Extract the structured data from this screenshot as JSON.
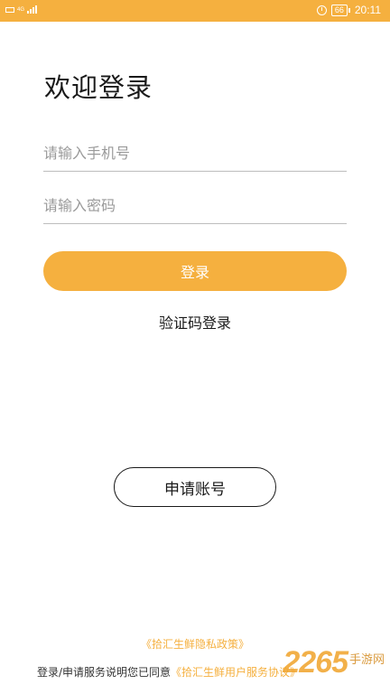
{
  "statusbar": {
    "network": "4G",
    "battery": "66",
    "time": "20:11",
    "icons": [
      "sim-icon",
      "signal-icon",
      "alarm-icon",
      "battery-icon"
    ]
  },
  "title": "欢迎登录",
  "form": {
    "phone_placeholder": "请输入手机号",
    "phone_value": "",
    "password_placeholder": "请输入密码",
    "password_value": ""
  },
  "login_label": "登录",
  "code_login_label": "验证码登录",
  "apply_label": "申请账号",
  "privacy_link": "《拾汇生鲜隐私政策》",
  "agreement": {
    "prefix": "登录/申请服务说明您已同意",
    "link": "《拾汇生鲜用户服务协议》"
  },
  "watermark": {
    "number": "2265",
    "name": "手游网"
  },
  "colors": {
    "accent": "#f5b03f",
    "text": "#1a1a1a",
    "placeholder": "#9a9a9a"
  }
}
